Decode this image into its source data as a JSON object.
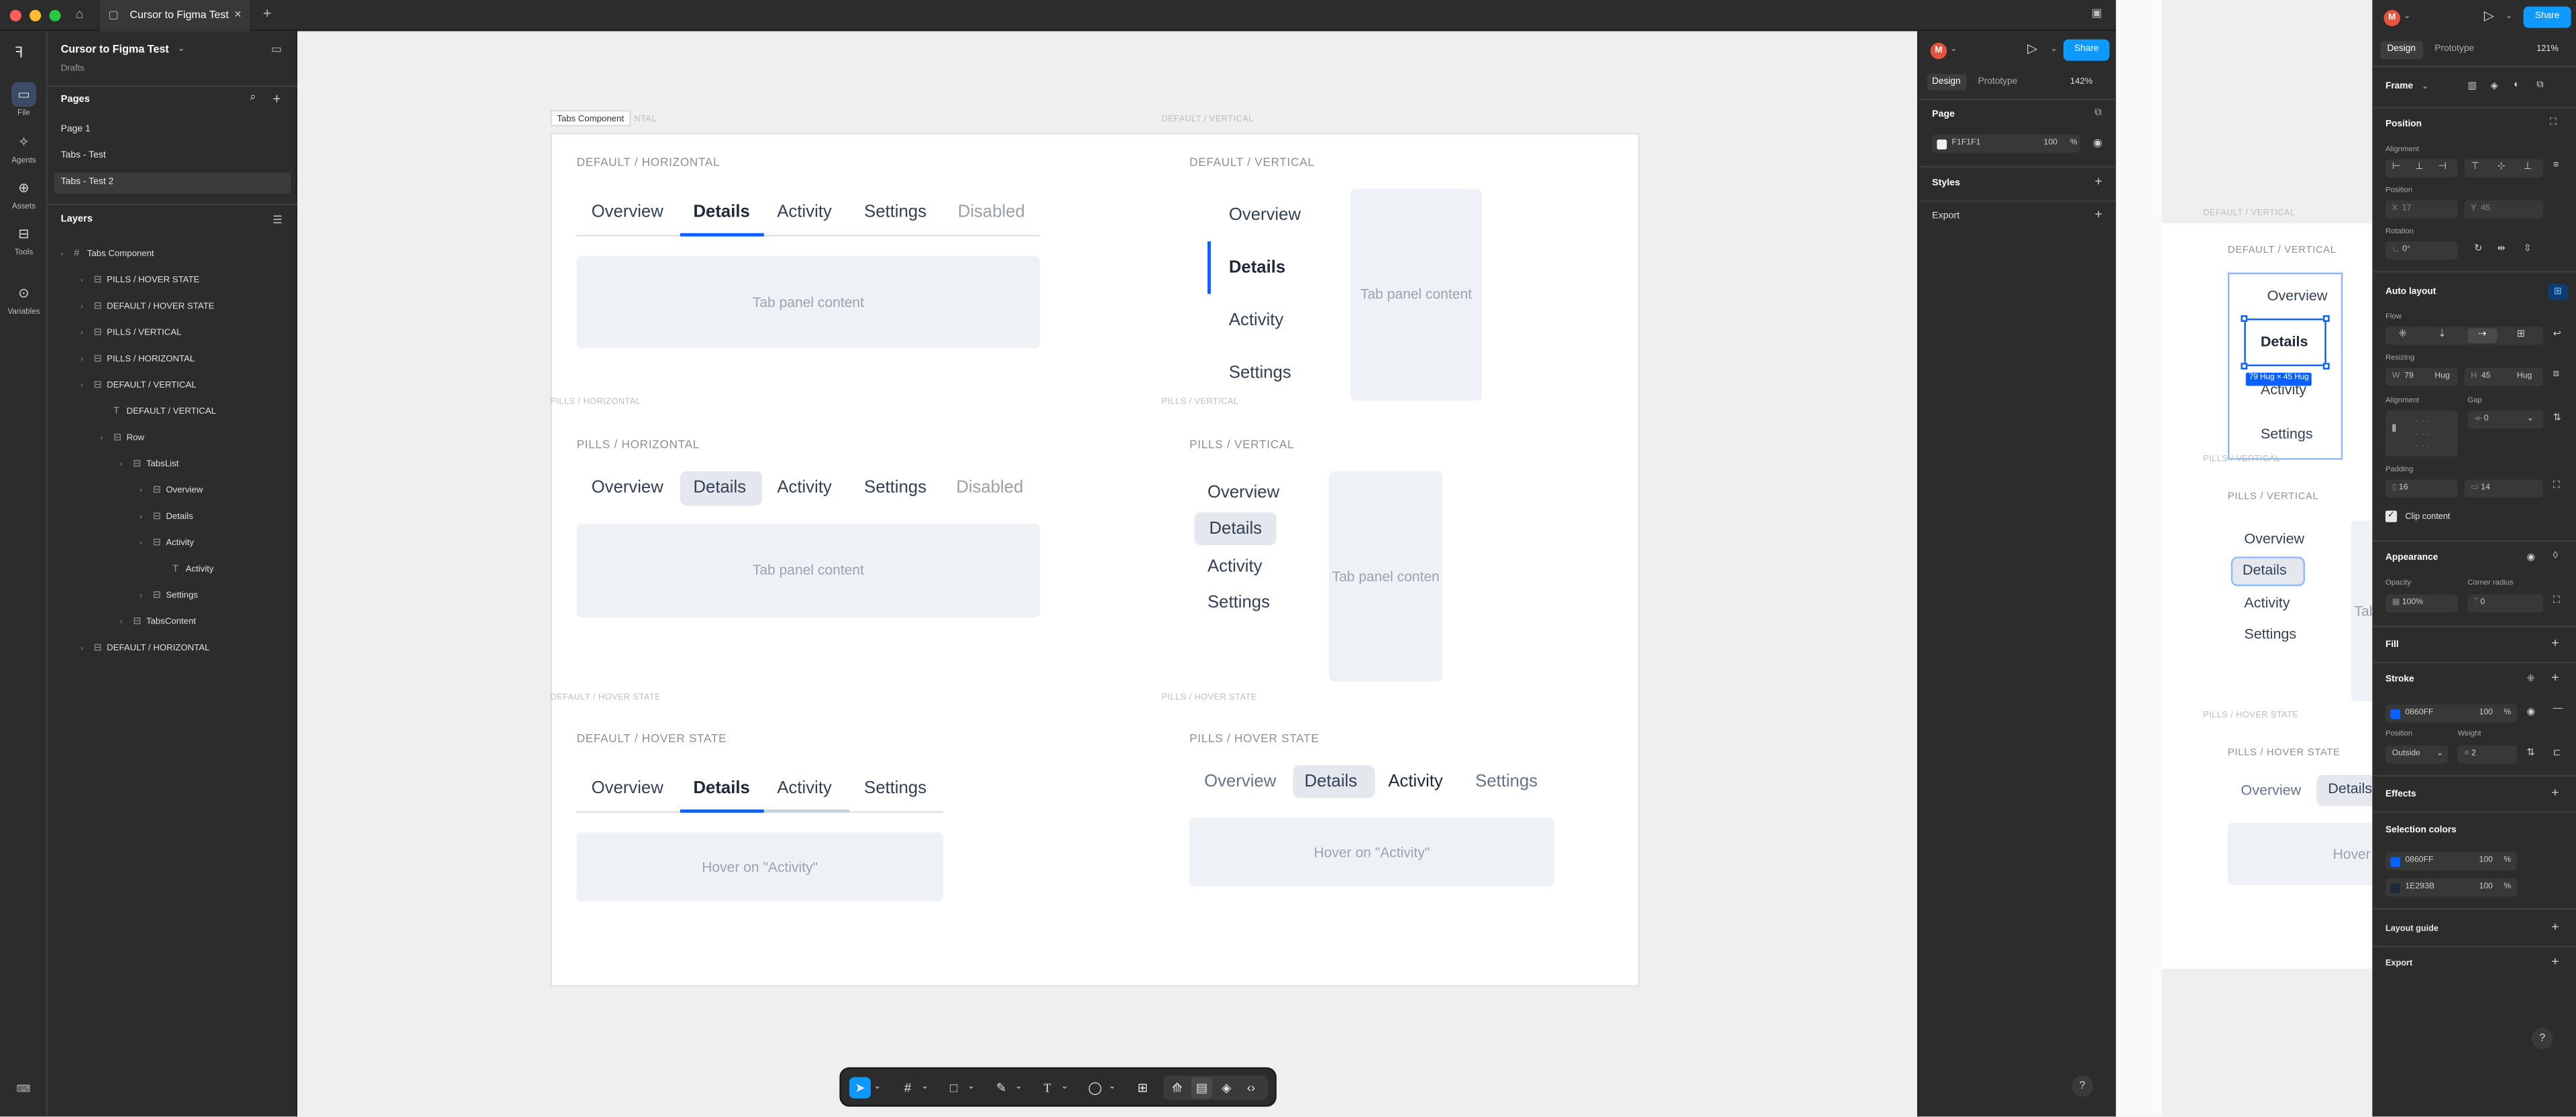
{
  "app": {
    "tab_title": "Cursor to Figma Test",
    "file_name": "Cursor to Figma Test",
    "file_location": "Drafts",
    "icons": {
      "home": "home-icon",
      "add_tab": "plus-icon",
      "close_tab": "close-icon"
    }
  },
  "rail": {
    "items": [
      {
        "label": "File",
        "icon": "file-icon"
      },
      {
        "label": "Agents",
        "icon": "agents-icon"
      },
      {
        "label": "Assets",
        "icon": "assets-icon"
      },
      {
        "label": "Tools",
        "icon": "tools-icon"
      },
      {
        "label": "Variables",
        "icon": "variables-icon"
      }
    ]
  },
  "pages": {
    "title": "Pages",
    "items": [
      "Page 1",
      "Tabs - Test",
      "Tabs - Test 2"
    ],
    "selected": "Tabs - Test 2"
  },
  "layers": {
    "title": "Layers",
    "items": [
      {
        "name": "Tabs Component",
        "depth": 0,
        "icon": "frame-icon"
      },
      {
        "name": "PILLS / HOVER STATE",
        "depth": 1,
        "icon": "autolayout-icon"
      },
      {
        "name": "DEFAULT / HOVER STATE",
        "depth": 1,
        "icon": "autolayout-icon"
      },
      {
        "name": "PILLS / VERTICAL",
        "depth": 1,
        "icon": "autolayout-icon"
      },
      {
        "name": "PILLS / HORIZONTAL",
        "depth": 1,
        "icon": "autolayout-icon"
      },
      {
        "name": "DEFAULT / VERTICAL",
        "depth": 1,
        "icon": "autolayout-icon"
      },
      {
        "name": "DEFAULT / VERTICAL",
        "depth": 2,
        "icon": "text-icon"
      },
      {
        "name": "Row",
        "depth": 2,
        "icon": "autolayout-icon"
      },
      {
        "name": "TabsList",
        "depth": 3,
        "icon": "autolayout-icon"
      },
      {
        "name": "Overview",
        "depth": 4,
        "icon": "autolayout-icon"
      },
      {
        "name": "Details",
        "depth": 4,
        "icon": "autolayout-icon"
      },
      {
        "name": "Activity",
        "depth": 4,
        "icon": "autolayout-icon"
      },
      {
        "name": "Activity",
        "depth": 5,
        "icon": "text-icon"
      },
      {
        "name": "Settings",
        "depth": 4,
        "icon": "autolayout-icon"
      },
      {
        "name": "TabsContent",
        "depth": 3,
        "icon": "autolayout-icon"
      },
      {
        "name": "DEFAULT / HORIZONTAL",
        "depth": 1,
        "icon": "autolayout-icon"
      }
    ]
  },
  "canvas": {
    "frame_tag": "Tabs Component",
    "frame_labels": {
      "default_horizontal_partial": "NTAL",
      "default_vertical": "DEFAULT / VERTICAL",
      "pills_horizontal": "PILLS / HORIZONTAL",
      "pills_vertical": "PILLS / VERTICAL",
      "default_hover": "DEFAULT / HOVER STATE",
      "pills_hover": "PILLS / HOVER STATE"
    },
    "sections": {
      "default_horizontal": "DEFAULT / HORIZONTAL",
      "default_vertical": "DEFAULT / VERTICAL",
      "pills_horizontal": "PILLS / HORIZONTAL",
      "pills_vertical": "PILLS / VERTICAL",
      "default_hover": "DEFAULT / HOVER STATE",
      "pills_hover": "PILLS / HOVER STATE"
    },
    "tabs5": [
      "Overview",
      "Details",
      "Activity",
      "Settings",
      "Disabled"
    ],
    "tabs4": [
      "Overview",
      "Details",
      "Activity",
      "Settings"
    ],
    "panel_text": "Tab panel content",
    "panel_text_cut": "Tab panel conten",
    "hover_text": "Hover on \"Activity\""
  },
  "right_panel": {
    "tabs": [
      "Design",
      "Prototype"
    ],
    "zoom": "142%",
    "share_label": "Share",
    "avatar_initial": "M",
    "page_section": "Page",
    "page_color": "F1F1F1",
    "page_opacity": "100",
    "percent": "%",
    "styles_label": "Styles",
    "export_label": "Export",
    "help_icon": "?"
  },
  "toolbar": {
    "tools": [
      "move-tool-icon",
      "frame-tool-icon",
      "shape-tool-icon",
      "pen-tool-icon",
      "text-tool-icon",
      "comment-tool-icon",
      "actions-icon",
      "draw-mode-icon",
      "design-mode-icon",
      "dev-mode-icon",
      "code-icon"
    ]
  },
  "canvas2": {
    "label_pills_vertical_frame": "PILLS / VERTICAL",
    "label_default_vertical_frame": "DEFAULT / VERTICAL",
    "label_default_vertical": "DEFAULT / VERTICAL",
    "label_pills_vertical": "PILLS / VERTICAL",
    "label_pills_hover_frame": "PILLS / HOVER STATE",
    "label_pills_hover": "PILLS / HOVER STATE",
    "tabs": [
      "Overview",
      "Details",
      "Activity",
      "Settings"
    ],
    "size_badge": "79 Hug × 45 Hug",
    "cut_details": "Details",
    "cut_tab": "Tab",
    "cut_hover": "Hover",
    "hover_overview": "Overview"
  },
  "design_panel": {
    "avatar_initial": "M",
    "share_label": "Share",
    "tabs": [
      "Design",
      "Prototype"
    ],
    "zoom": "121%",
    "frame_label": "Frame",
    "position_title": "Position",
    "alignment_label": "Alignment",
    "position_label": "Position",
    "x_label": "X",
    "x_value": "17",
    "y_label": "Y",
    "y_value": "45",
    "rotation_label": "Rotation",
    "rotation_value": "0°",
    "auto_layout_title": "Auto layout",
    "flow_label": "Flow",
    "resizing_label": "Resizing",
    "w_label": "W",
    "w_value": "79",
    "w_mode": "Hug",
    "h_label": "H",
    "h_value": "45",
    "h_mode": "Hug",
    "align_label": "Alignment",
    "gap_label": "Gap",
    "gap_value": "0",
    "padding_label": "Padding",
    "pad_h": "16",
    "pad_v": "14",
    "clip_content": "Clip content",
    "appearance_title": "Appearance",
    "opacity_label": "Opacity",
    "opacity_value": "100%",
    "radius_label": "Corner radius",
    "radius_value": "0",
    "fill_title": "Fill",
    "stroke_title": "Stroke",
    "stroke_color": "0860FF",
    "stroke_opacity": "100",
    "stroke_position_label": "Position",
    "stroke_position": "Outside",
    "weight_label": "Weight",
    "weight_value": "2",
    "effects_title": "Effects",
    "selection_colors_title": "Selection colors",
    "sel_colors": [
      {
        "hex": "0860FF",
        "opacity": "100"
      },
      {
        "hex": "1E293B",
        "opacity": "100"
      }
    ],
    "percent": "%",
    "layout_guide": "Layout guide",
    "export_title": "Export",
    "help_icon": "?"
  },
  "colors": {
    "accent": "#0860FF",
    "figma_blue": "#0D99FF",
    "text_dark": "#1E293B",
    "page_bg": "#F1F1F1"
  }
}
